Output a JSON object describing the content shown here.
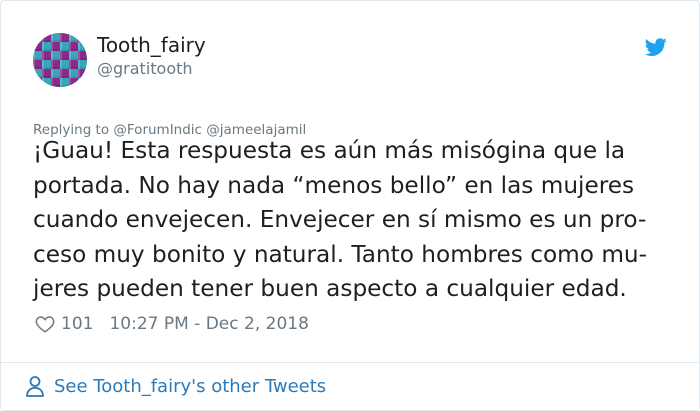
{
  "tweet": {
    "author": {
      "display_name": "Tooth_fairy",
      "handle": "@gratitooth"
    },
    "replying_to": "Replying to @ForumIndic @jameelajamil",
    "text_lines": [
      "¡Guau! Esta respuesta es aún más misógina que la",
      "portada. No hay nada “menos bello” en las mujeres",
      "cuando envejecen. Envejecer en sí mismo es un pro-",
      "ceso muy bonito y natural. Tanto hombres como mu-",
      "jeres pueden tener buen aspecto a cualquier edad."
    ],
    "likes": "101",
    "timestamp": "10:27 PM - Dec 2, 2018"
  },
  "footer": {
    "other_tweets_link": "See Tooth_fairy's other Tweets"
  },
  "colors": {
    "brand": "#1da1f2",
    "link": "#2b7bb9",
    "muted": "#697882",
    "text": "#1c2022"
  },
  "icons": {
    "logo": "twitter-bird-icon",
    "like": "heart-icon",
    "profile": "person-icon"
  }
}
